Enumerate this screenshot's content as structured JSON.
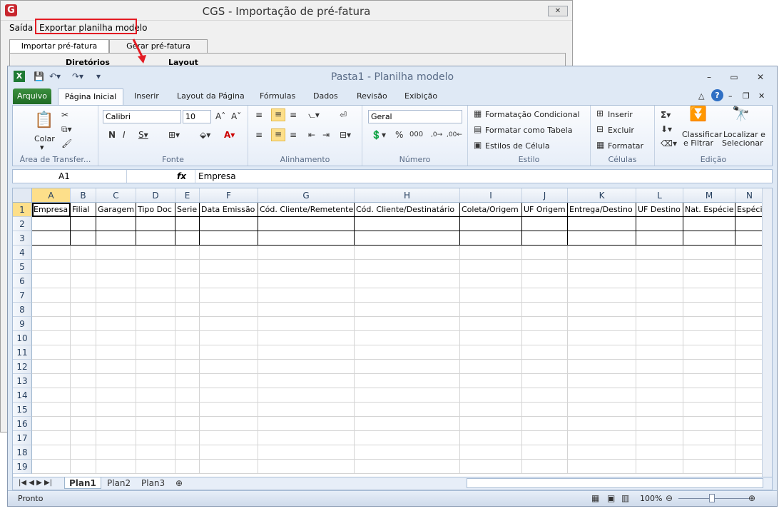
{
  "cgs": {
    "logo": "G",
    "title": "CGS - Importação de pré-fatura",
    "close": "✕",
    "menu_saida": "Saída",
    "menu_exportar": "Exportar planilha modelo",
    "tab_importar": "Importar pré-fatura",
    "tab_gerar": "Gerar pré-fatura",
    "panel_diretorios": "Diretórios",
    "panel_layout": "Layout"
  },
  "excel": {
    "title": "Pasta1  -  Planilha modelo",
    "tabs": [
      "Arquivo",
      "Página Inicial",
      "Inserir",
      "Layout da Página",
      "Fórmulas",
      "Dados",
      "Revisão",
      "Exibição"
    ],
    "clipboard": {
      "label": "Área de Transfer...",
      "paste": "Colar"
    },
    "font": {
      "label": "Fonte",
      "name": "Calibri",
      "size": "10"
    },
    "alignment": {
      "label": "Alinhamento"
    },
    "number": {
      "label": "Número",
      "format": "Geral"
    },
    "styles": {
      "label": "Estilo",
      "cond": "Formatação Condicional",
      "table": "Formatar como Tabela",
      "cell": "Estilos de Célula"
    },
    "cells": {
      "label": "Células",
      "insert": "Inserir",
      "delete": "Excluir",
      "format": "Formatar"
    },
    "editing": {
      "label": "Edição",
      "sort1": "Classificar",
      "sort2": "e Filtrar",
      "find1": "Localizar e",
      "find2": "Selecionar"
    },
    "namebox": "A1",
    "fx": "fx",
    "formula": "Empresa",
    "columns": [
      "A",
      "B",
      "C",
      "D",
      "E",
      "F",
      "G",
      "H",
      "I",
      "J",
      "K",
      "L",
      "M",
      "N"
    ],
    "headers": [
      "Empresa",
      "Filial",
      "Garagem",
      "Tipo Doc",
      "Serie",
      "Data Emissão",
      "Cód. Cliente/Remetente",
      "Cód. Cliente/Destinatário",
      "Coleta/Origem",
      "UF Origem",
      "Entrega/Destino",
      "UF Destino",
      "Nat. Espécie",
      "Espécie"
    ],
    "rows": [
      "1",
      "2",
      "3",
      "4",
      "5",
      "6",
      "7",
      "8",
      "9",
      "10",
      "11",
      "12",
      "13",
      "14",
      "15",
      "16",
      "17",
      "18",
      "19"
    ],
    "sheets": [
      "Plan1",
      "Plan2",
      "Plan3"
    ],
    "status": "Pronto",
    "zoom": "100%"
  }
}
